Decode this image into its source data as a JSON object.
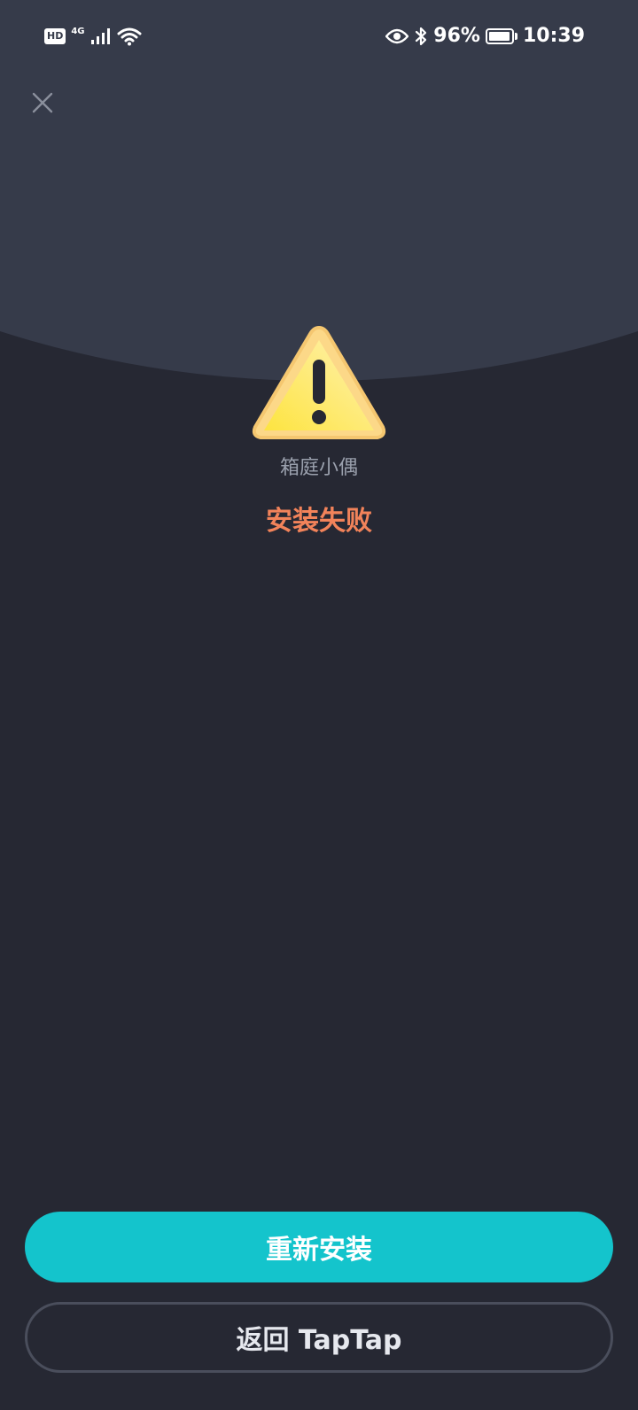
{
  "status_bar": {
    "hd_label": "HD",
    "network_label": "4G",
    "battery_percent_text": "96%",
    "battery_level": 0.96,
    "time": "10:39",
    "icons": [
      "signal-icon",
      "wifi-icon",
      "eye-icon",
      "bluetooth-icon",
      "battery-icon"
    ]
  },
  "dialog": {
    "app_name": "箱庭小偶",
    "status": "安装失败",
    "icon": "warning-icon"
  },
  "actions": {
    "reinstall_label": "重新安装",
    "back_label": "返回 TapTap"
  },
  "colors": {
    "background": "#262833",
    "arc": "#363b4a",
    "error_text": "#f2835a",
    "primary_button": "#14c4cc",
    "secondary_border": "#4a4e5c",
    "warning_yellow": "#fde35a"
  }
}
